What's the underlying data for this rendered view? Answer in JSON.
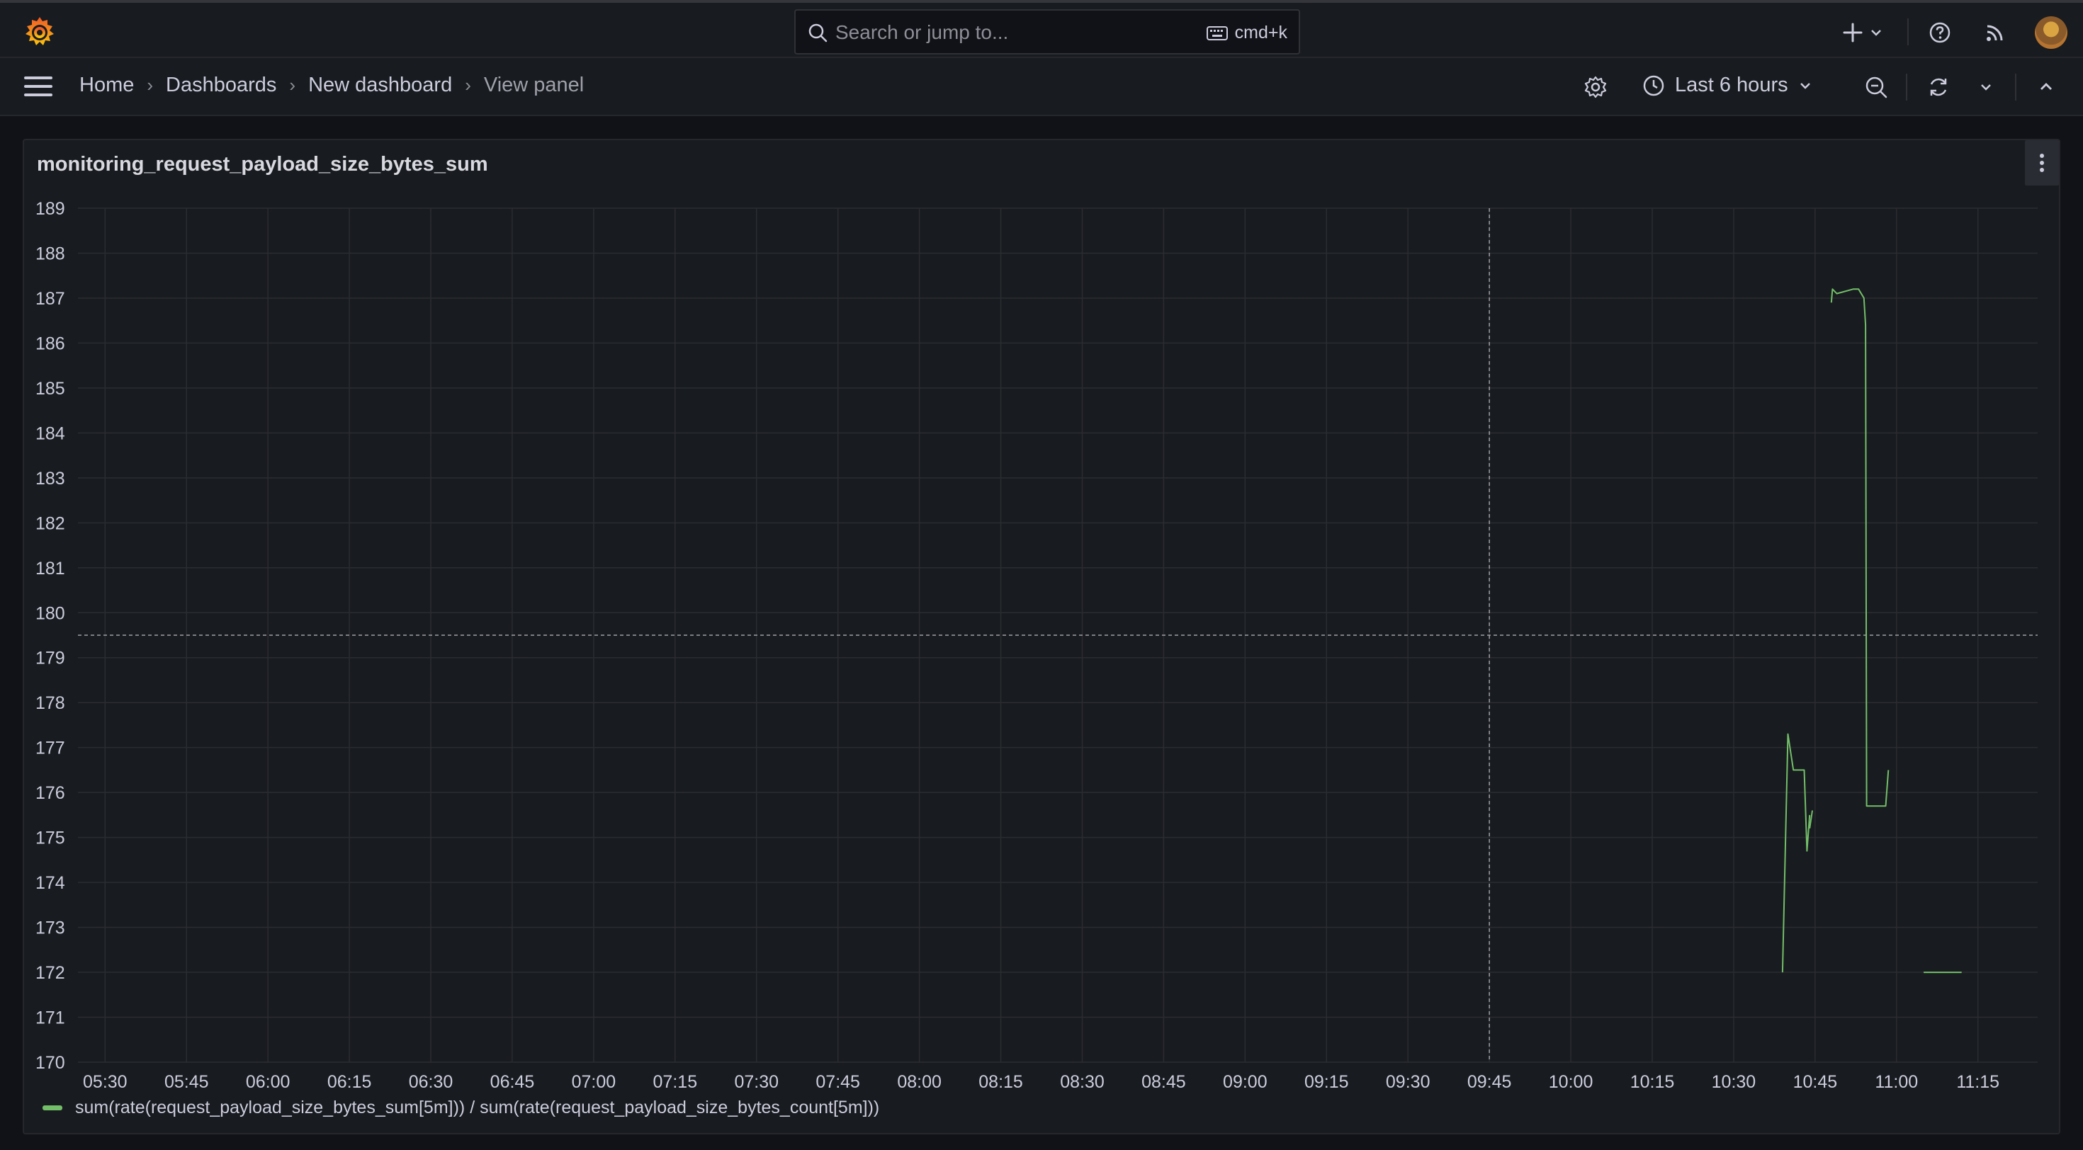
{
  "search": {
    "placeholder": "Search or jump to...",
    "shortcut": "cmd+k"
  },
  "breadcrumb": [
    "Home",
    "Dashboards",
    "New dashboard",
    "View panel"
  ],
  "time_picker": {
    "label": "Last 6 hours"
  },
  "panel": {
    "title": "monitoring_request_payload_size_bytes_sum"
  },
  "legend": {
    "series_name": "sum(rate(request_payload_size_bytes_sum[5m])) / sum(rate(request_payload_size_bytes_count[5m]))",
    "color": "#73bf69"
  },
  "chart_data": {
    "type": "line",
    "title": "monitoring_request_payload_size_bytes_sum",
    "ylim": [
      170,
      189
    ],
    "yticks": [
      170,
      171,
      172,
      173,
      174,
      175,
      176,
      177,
      178,
      179,
      180,
      181,
      182,
      183,
      184,
      185,
      186,
      187,
      188,
      189
    ],
    "xticks": [
      "05:30",
      "05:45",
      "06:00",
      "06:15",
      "06:30",
      "06:45",
      "07:00",
      "07:15",
      "07:30",
      "07:45",
      "08:00",
      "08:15",
      "08:30",
      "08:45",
      "09:00",
      "09:15",
      "09:30",
      "09:45",
      "10:00",
      "10:15",
      "10:30",
      "10:45",
      "11:00",
      "11:15"
    ],
    "x_range": [
      "05:25",
      "11:26"
    ],
    "grid": true,
    "crosshair": {
      "x": "09:45",
      "y": 179.5
    },
    "series": [
      {
        "name": "sum(rate(request_payload_size_bytes_sum[5m])) / sum(rate(request_payload_size_bytes_count[5m]))",
        "color": "#73bf69",
        "segments": [
          [
            [
              "10:39",
              172.0
            ],
            [
              "10:40",
              177.3
            ],
            [
              "10:41",
              176.5
            ],
            [
              "10:43",
              176.5
            ],
            [
              "10:43.5",
              174.7
            ],
            [
              "10:44",
              175.5
            ]
          ],
          [
            [
              "10:44",
              175.2
            ],
            [
              "10:44.5",
              175.6
            ]
          ],
          [
            [
              "10:48",
              186.9
            ],
            [
              "10:48.2",
              187.2
            ],
            [
              "10:49",
              187.1
            ],
            [
              "10:52",
              187.2
            ],
            [
              "10:53",
              187.2
            ],
            [
              "10:54",
              187.0
            ],
            [
              "10:54.3",
              186.4
            ],
            [
              "10:54.5",
              175.7
            ],
            [
              "10:58",
              175.7
            ],
            [
              "10:58.5",
              176.5
            ]
          ],
          [
            [
              "11:05",
              172.0
            ],
            [
              "11:12",
              172.0
            ]
          ]
        ]
      }
    ]
  }
}
